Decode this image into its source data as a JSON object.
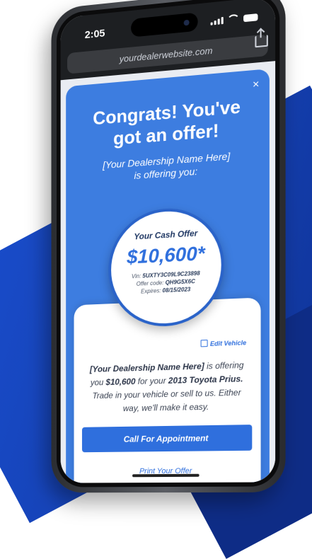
{
  "status": {
    "time": "2:05"
  },
  "browser": {
    "url": "yourdealerwebsite.com"
  },
  "modal": {
    "close_label": "×",
    "headline_line1": "Congrats! You've",
    "headline_line2": "got an offer!",
    "dealer_line": "[Your Dealership Name Here]",
    "offering_line": "is offering you:"
  },
  "offer": {
    "label": "Your Cash Offer",
    "amount": "$10,600*",
    "vin_label": "Vin:",
    "vin": "5UXTY3C09L9C23898",
    "code_label": "Offer code:",
    "code": "QH9G5X6C",
    "expires_label": "Expires:",
    "expires": "08/15/2023"
  },
  "card": {
    "edit_label": "Edit Vehicle",
    "dealer_name": "[Your Dealership Name Here]",
    "text_is": " is offering you ",
    "amount": "$10,600",
    "text_for": " for your ",
    "vehicle": "2013 Toyota Prius.",
    "text_rest": " Trade in your vehicle or sell to us. Either way, we'll make it easy.",
    "cta_label": "Call For Appointment",
    "print_label": "Print Your Offer"
  },
  "colors": {
    "brand_blue": "#3d7de0",
    "button_blue": "#2f6fdd",
    "background_blue": "#1a4fd0"
  },
  "icons": [
    "signal-icon",
    "wifi-icon",
    "battery-icon",
    "share-icon",
    "close-icon",
    "edit-icon"
  ]
}
